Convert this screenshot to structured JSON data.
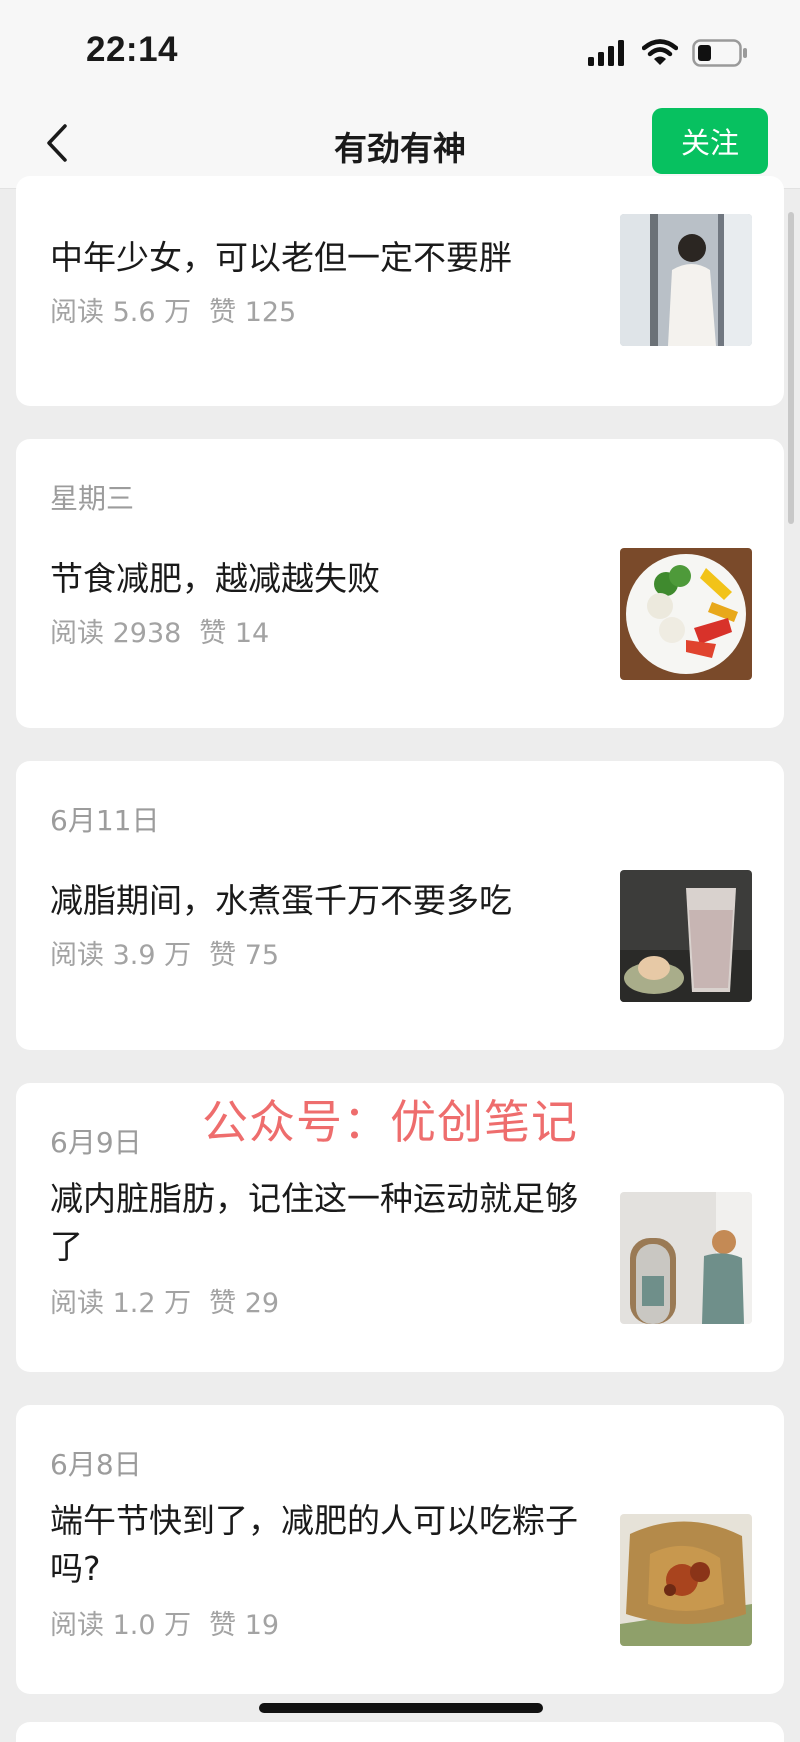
{
  "status_bar": {
    "time": "22:14"
  },
  "nav": {
    "title": "有劲有神",
    "follow_label": "关注"
  },
  "articles": [
    {
      "date": "",
      "title": "中年少女，可以老但一定不要胖",
      "reads": "阅读 5.6 万",
      "likes": "赞 125"
    },
    {
      "date": "星期三",
      "title": "节食减肥，越减越失败",
      "reads": "阅读 2938",
      "likes": "赞 14"
    },
    {
      "date": "6月11日",
      "title": "减脂期间，水煮蛋千万不要多吃",
      "reads": "阅读 3.9 万",
      "likes": "赞 75"
    },
    {
      "date": "6月9日",
      "title": "减内脏脂肪，记住这一种运动就足够了",
      "reads": "阅读 1.2 万",
      "likes": "赞 29"
    },
    {
      "date": "6月8日",
      "title": "端午节快到了，减肥的人可以吃粽子吗?",
      "reads": "阅读 1.0 万",
      "likes": "赞 19"
    }
  ],
  "watermark": "公众号：优创笔记",
  "colors": {
    "accent": "#07c160",
    "background": "#ededed",
    "watermark": "#ee6d6d"
  }
}
